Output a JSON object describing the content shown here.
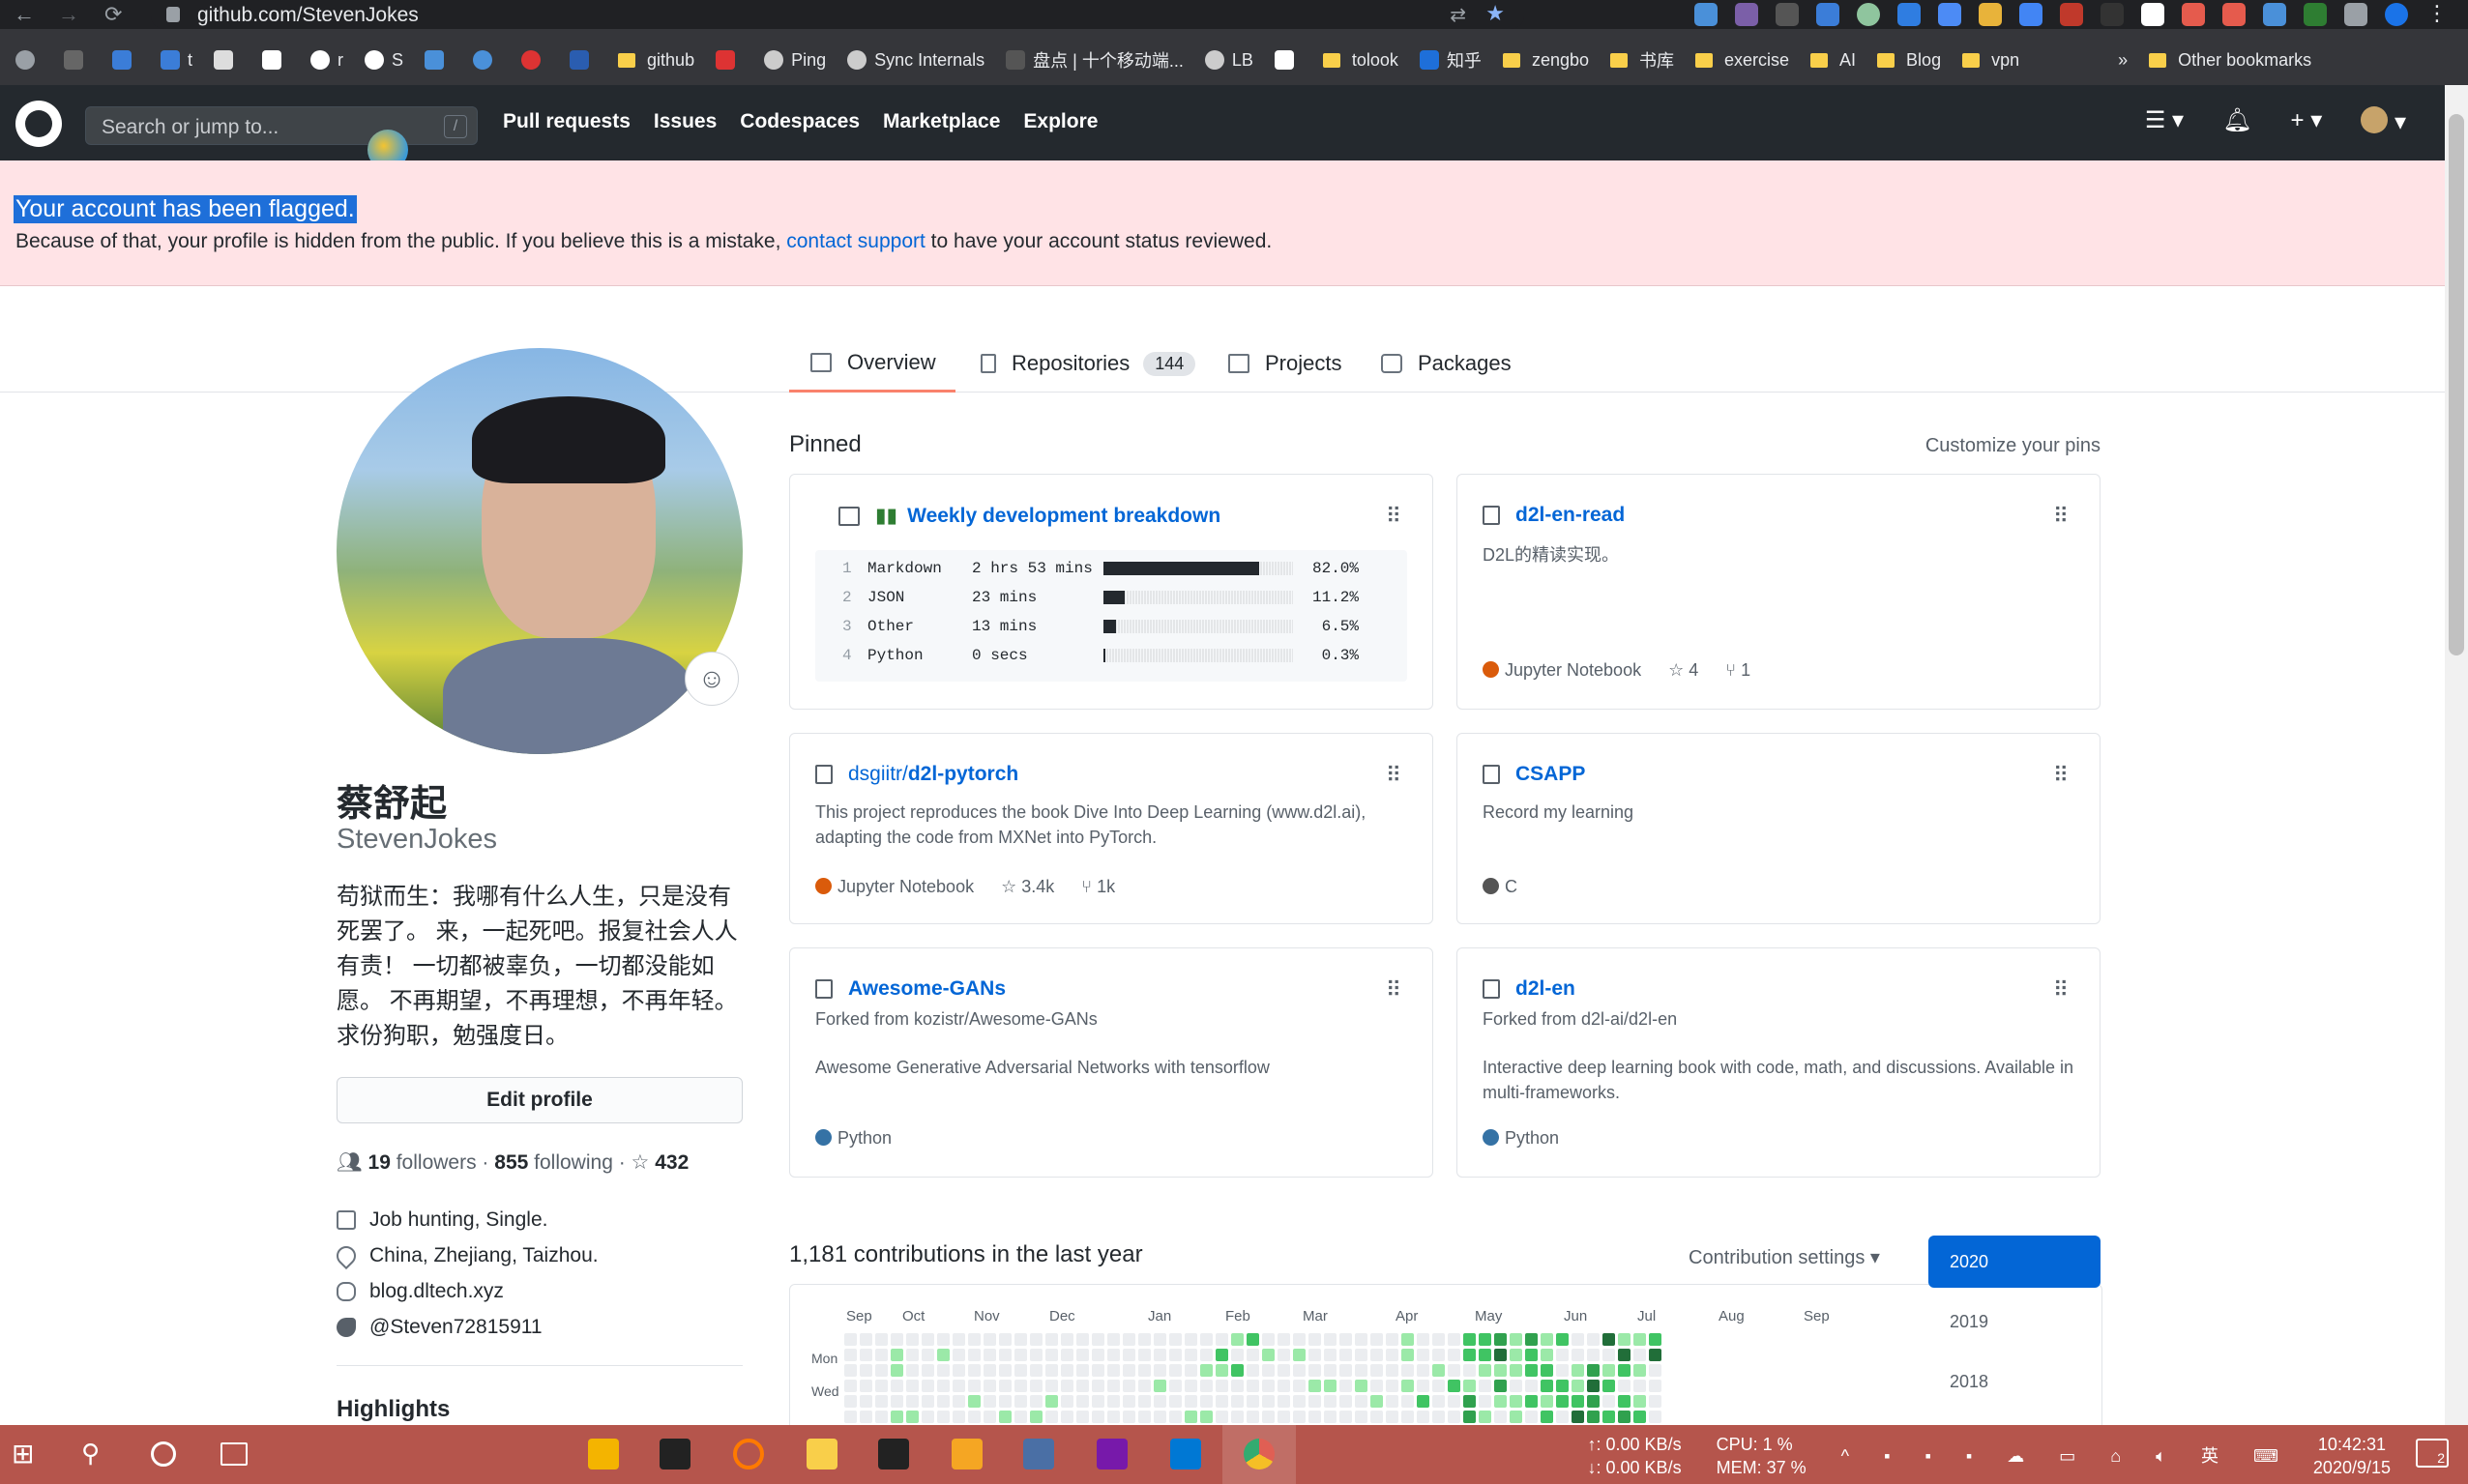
{
  "browser": {
    "url": "github.com/StevenJokes",
    "bookmarks": [
      "github",
      "Ping",
      "Sync Internals",
      "盘点 | 十个移动端...",
      "LB",
      "tolook",
      "知乎",
      "zengbo",
      "书库",
      "exercise",
      "AI",
      "Blog",
      "vpn"
    ],
    "other_bookmarks": "Other bookmarks",
    "more": "»"
  },
  "gh": {
    "search_placeholder": "Search or jump to...",
    "slash": "/",
    "nav": [
      "Pull requests",
      "Issues",
      "Codespaces",
      "Marketplace",
      "Explore"
    ]
  },
  "flash": {
    "title": "Your account has been flagged.",
    "text_before": "Because of that, your profile is hidden from the public. If you believe this is a mistake, ",
    "link": "contact support",
    "text_after": " to have your account status reviewed."
  },
  "tabs": [
    {
      "label": "Overview"
    },
    {
      "label": "Repositories",
      "count": "144"
    },
    {
      "label": "Projects"
    },
    {
      "label": "Packages"
    }
  ],
  "profile": {
    "name": "蔡舒起",
    "login": "StevenJokes",
    "bio": "苟狱而生：我哪有什么人生，只是没有死罢了。 来，一起死吧。报复社会人人有责！ 一切都被辜负，一切都没能如愿。 不再期望，不再理想，不再年轻。求份狗职，勉强度日。",
    "edit": "Edit profile",
    "followers": "19",
    "followers_label": "followers",
    "following": "855",
    "following_label": "following",
    "stars": "432",
    "company": "Job hunting, Single.",
    "location": "China, Zhejiang, Taizhou.",
    "blog": "blog.dltech.xyz",
    "twitter": "@Steven72815911",
    "highlights": "Highlights"
  },
  "pinned": {
    "title": "Pinned",
    "customize": "Customize your pins",
    "gist": {
      "title": "Weekly development breakdown",
      "rows": [
        {
          "n": "1",
          "lang": "Markdown",
          "time": "2 hrs 53 mins",
          "pct": "82.0%",
          "fill": 0.82
        },
        {
          "n": "2",
          "lang": "JSON",
          "time": "23 mins",
          "pct": "11.2%",
          "fill": 0.112
        },
        {
          "n": "3",
          "lang": "Other",
          "time": "13 mins",
          "pct": "6.5%",
          "fill": 0.065
        },
        {
          "n": "4",
          "lang": "Python",
          "time": "0 secs",
          "pct": "0.3%",
          "fill": 0.003
        }
      ]
    },
    "repos": [
      {
        "title": "d2l-en-read",
        "desc": "D2L的精读实现。",
        "lang": "Jupyter Notebook",
        "color": "#DA5B0B",
        "stars": "4",
        "forks": "1"
      },
      {
        "owner": "dsgiitr/",
        "title": "d2l-pytorch",
        "desc": "This project reproduces the book Dive Into Deep Learning (www.d2l.ai), adapting the code from MXNet into PyTorch.",
        "lang": "Jupyter Notebook",
        "color": "#DA5B0B",
        "stars": "3.4k",
        "forks": "1k"
      },
      {
        "title": "CSAPP",
        "desc": "Record my learning",
        "lang": "C",
        "color": "#555555"
      },
      {
        "title": "Awesome-GANs",
        "forked": "Forked from kozistr/Awesome-GANs",
        "desc": "Awesome Generative Adversarial Networks with tensorflow",
        "lang": "Python",
        "color": "#3572A5"
      },
      {
        "title": "d2l-en",
        "forked": "Forked from d2l-ai/d2l-en",
        "desc": "Interactive deep learning book with code, math, and discussions. Available in multi-frameworks.",
        "lang": "Python",
        "color": "#3572A5"
      }
    ]
  },
  "contrib": {
    "title": "1,181 contributions in the last year",
    "settings": "Contribution settings ▾",
    "months": [
      "Sep",
      "Oct",
      "Nov",
      "Dec",
      "Jan",
      "Feb",
      "Mar",
      "Apr",
      "May",
      "Jun",
      "Jul",
      "Aug",
      "Sep"
    ],
    "days": [
      "Mon",
      "Wed"
    ],
    "years": [
      "2020",
      "2019",
      "2018"
    ]
  },
  "taskbar": {
    "net_up": "↑: 0.00 KB/s",
    "net_down": "↓: 0.00 KB/s",
    "cpu": "CPU:  1 %",
    "mem": "MEM: 37 %",
    "ime": "英",
    "time": "10:42:31",
    "date": "2020/9/15",
    "notif": "2"
  },
  "colors": {
    "accent": "#0366d6",
    "flash_bg": "#ffe3e6",
    "tab_active": "#f9826c",
    "taskbar": "#b5554c"
  }
}
